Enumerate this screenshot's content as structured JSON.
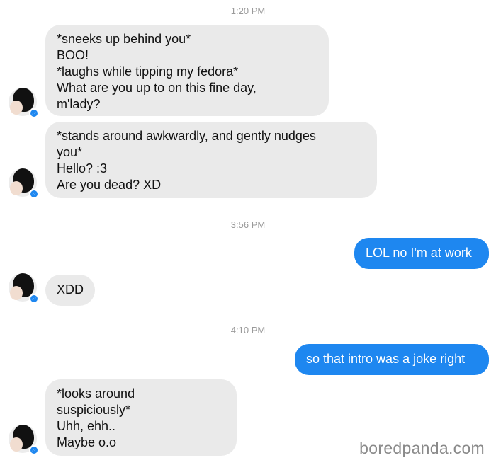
{
  "timestamps": [
    "1:20 PM",
    "3:56 PM",
    "4:10 PM"
  ],
  "messages": [
    {
      "from": "them",
      "text": "*sneeks up behind you*\nBOO!\n*laughs while tipping my fedora*\nWhat are you up to on this fine day,\nm'lady?"
    },
    {
      "from": "them",
      "text": "*stands around awkwardly, and gently nudges\nyou*\nHello? :3\nAre you dead? XD"
    },
    {
      "from": "me",
      "text": "LOL no I'm at work"
    },
    {
      "from": "them",
      "text": "XDD"
    },
    {
      "from": "me",
      "text": "so that intro was a joke right"
    },
    {
      "from": "them",
      "text": "*looks around\nsuspiciously*\nUhh, ehh..\nMaybe o.o"
    }
  ],
  "avatar_badge_icon": "messenger-icon",
  "watermark": "boredpanda.com",
  "colors": {
    "incoming_bubble": "#eaeaea",
    "outgoing_bubble": "#1e87f0",
    "timestamp": "#9a9a9a"
  }
}
